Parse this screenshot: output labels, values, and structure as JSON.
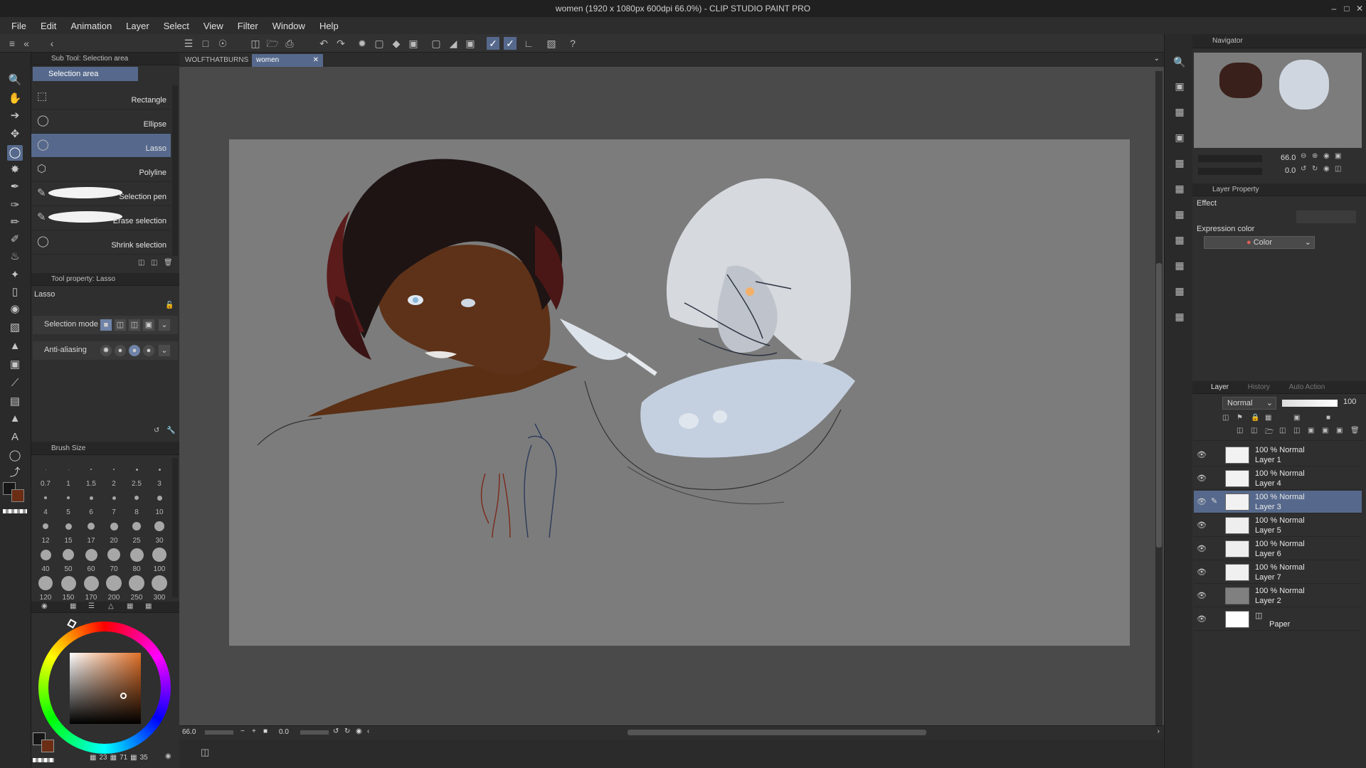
{
  "window": {
    "title": "women (1920 x 1080px 600dpi 66.0%) - CLIP STUDIO PAINT PRO"
  },
  "menu": [
    "File",
    "Edit",
    "Animation",
    "Layer",
    "Select",
    "View",
    "Filter",
    "Window",
    "Help"
  ],
  "subtool": {
    "header": "Sub Tool: Selection area",
    "group": "Selection area",
    "items": [
      "Rectangle",
      "Ellipse",
      "Lasso",
      "Polyline",
      "Selection pen",
      "Erase selection",
      "Shrink selection"
    ]
  },
  "toolprop": {
    "header": "Tool property: Lasso",
    "name": "Lasso",
    "selection_mode_label": "Selection mode",
    "antialiasing_label": "Anti-aliasing"
  },
  "brushsize": {
    "header": "Brush Size",
    "sizes": [
      "0.7",
      "1",
      "1.5",
      "2",
      "2.5",
      "3",
      "4",
      "5",
      "6",
      "7",
      "8",
      "10",
      "12",
      "15",
      "17",
      "20",
      "25",
      "30",
      "40",
      "50",
      "60",
      "70",
      "80",
      "100",
      "120",
      "150",
      "170",
      "200",
      "250",
      "300"
    ]
  },
  "color": {
    "main": "#161616",
    "sub": "#6b2d14",
    "picker_hue": "#e07028",
    "values": {
      "a": "23",
      "b": "71",
      "c": "35"
    }
  },
  "doc_tabs": [
    "WOLFTHATBURNS",
    "women"
  ],
  "status": {
    "zoom": "66.0",
    "rotation": "0.0"
  },
  "navigator": {
    "header": "Navigator",
    "zoom": "66.0",
    "rotation": "0.0"
  },
  "layer_property": {
    "header": "Layer Property",
    "effect": "Effect",
    "expression_color": "Expression color",
    "color_value": "Color"
  },
  "layer_panel": {
    "tabs": [
      "Layer",
      "History",
      "Auto Action"
    ],
    "blend_mode": "Normal",
    "opacity": "100",
    "layers": [
      {
        "mode": "100 % Normal",
        "name": "Layer 1",
        "selected": false
      },
      {
        "mode": "100 % Normal",
        "name": "Layer 4",
        "selected": false
      },
      {
        "mode": "100 % Normal",
        "name": "Layer 3",
        "selected": true
      },
      {
        "mode": "100 % Normal",
        "name": "Layer 5",
        "selected": false
      },
      {
        "mode": "100 % Normal",
        "name": "Layer 6",
        "selected": false
      },
      {
        "mode": "100 % Normal",
        "name": "Layer 7",
        "selected": false
      },
      {
        "mode": "100 % Normal",
        "name": "Layer 2",
        "selected": false
      }
    ],
    "paper": "Paper"
  }
}
